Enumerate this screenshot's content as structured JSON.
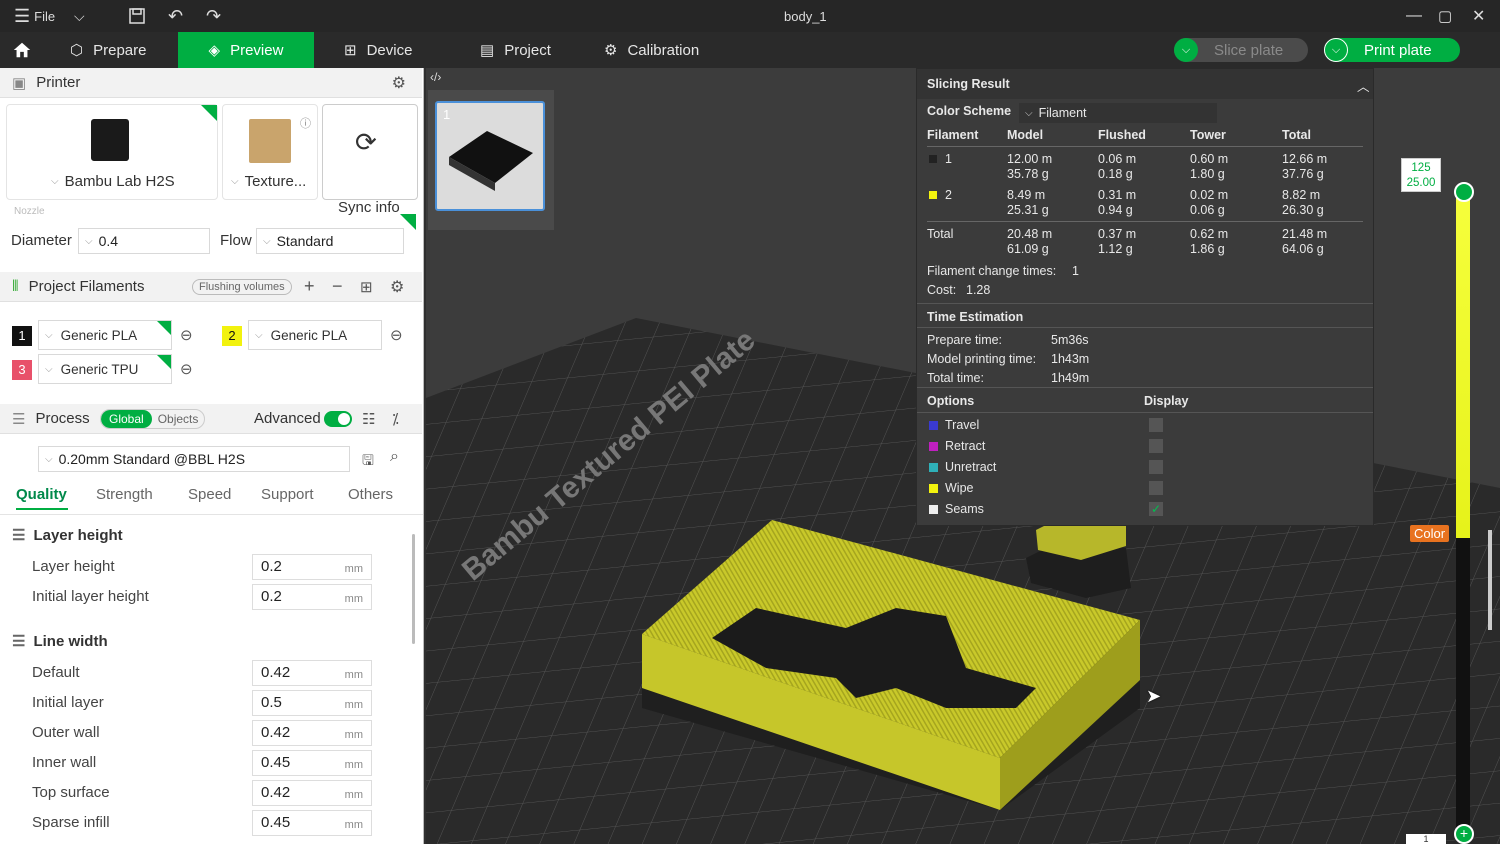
{
  "title": {
    "menu_icon": "hamburger-icon",
    "file": "File",
    "doc": "body_1"
  },
  "nav": {
    "home": "home-icon",
    "prepare": "Prepare",
    "preview": "Preview",
    "device": "Device",
    "project": "Project",
    "calibration": "Calibration",
    "slice": "Slice plate",
    "print": "Print plate"
  },
  "printer": {
    "header": "Printer",
    "model": "Bambu Lab H2S",
    "plate": "Texture...",
    "sync": "Sync info",
    "nozzle": "Nozzle",
    "diameter_label": "Diameter",
    "diameter": "0.4",
    "flow_label": "Flow",
    "flow": "Standard"
  },
  "filaments": {
    "header": "Project Filaments",
    "flushing": "Flushing volumes",
    "items": [
      {
        "idx": "1",
        "name": "Generic PLA",
        "color": "#111111"
      },
      {
        "idx": "2",
        "name": "Generic PLA",
        "color": "#f2f20e"
      },
      {
        "idx": "3",
        "name": "Generic TPU",
        "color": "#e8516a"
      }
    ]
  },
  "process": {
    "header": "Process",
    "global": "Global",
    "objects": "Objects",
    "advanced": "Advanced",
    "preset": "0.20mm Standard @BBL H2S",
    "tabs": [
      "Quality",
      "Strength",
      "Speed",
      "Support",
      "Others"
    ],
    "g1": "Layer height",
    "g2": "Line width",
    "rows": [
      {
        "label": "Layer height",
        "value": "0.2",
        "unit": "mm"
      },
      {
        "label": "Initial layer height",
        "value": "0.2",
        "unit": "mm"
      },
      {
        "label": "Default",
        "value": "0.42",
        "unit": "mm"
      },
      {
        "label": "Initial layer",
        "value": "0.5",
        "unit": "mm"
      },
      {
        "label": "Outer wall",
        "value": "0.42",
        "unit": "mm"
      },
      {
        "label": "Inner wall",
        "value": "0.45",
        "unit": "mm"
      },
      {
        "label": "Top surface",
        "value": "0.42",
        "unit": "mm"
      },
      {
        "label": "Sparse infill",
        "value": "0.45",
        "unit": "mm"
      }
    ]
  },
  "thumb": {
    "index": "1"
  },
  "result": {
    "header": "Slicing Result",
    "scheme_label": "Color Scheme",
    "scheme": "Filament",
    "cols": [
      "Filament",
      "Model",
      "Flushed",
      "Tower",
      "Total"
    ],
    "rows": [
      {
        "f": "1",
        "sw": "#222222",
        "model": [
          "12.00 m",
          "35.78 g"
        ],
        "flushed": [
          "0.06 m",
          "0.18 g"
        ],
        "tower": [
          "0.60 m",
          "1.80 g"
        ],
        "total": [
          "12.66 m",
          "37.76 g"
        ]
      },
      {
        "f": "2",
        "sw": "#f2f20e",
        "model": [
          "8.49 m",
          "25.31 g"
        ],
        "flushed": [
          "0.31 m",
          "0.94 g"
        ],
        "tower": [
          "0.02 m",
          "0.06 g"
        ],
        "total": [
          "8.82 m",
          "26.30 g"
        ]
      }
    ],
    "total": {
      "label": "Total",
      "model": [
        "20.48 m",
        "61.09 g"
      ],
      "flushed": [
        "0.37 m",
        "1.12 g"
      ],
      "tower": [
        "0.62 m",
        "1.86 g"
      ],
      "total": [
        "21.48 m",
        "64.06 g"
      ]
    },
    "change": "Filament change times:",
    "change_val": "1",
    "cost": "Cost:",
    "cost_val": "1.28",
    "time_header": "Time Estimation",
    "times": [
      {
        "l": "Prepare time:",
        "v": "5m36s"
      },
      {
        "l": "Model printing time:",
        "v": "1h43m"
      },
      {
        "l": "Total time:",
        "v": "1h49m"
      }
    ],
    "options_label": "Options",
    "display_label": "Display",
    "options": [
      {
        "n": "Travel",
        "c": "#3a3ad0",
        "on": false
      },
      {
        "n": "Retract",
        "c": "#c020c0",
        "on": false
      },
      {
        "n": "Unretract",
        "c": "#2fb0b8",
        "on": false
      },
      {
        "n": "Wipe",
        "c": "#f2f20e",
        "on": false
      },
      {
        "n": "Seams",
        "c": "#eeeeee",
        "on": true
      }
    ]
  },
  "layer": {
    "top": "125",
    "height": "25.00",
    "bottom": "1",
    "color_btn": "Color"
  },
  "plate_text": "Bambu Textured PEI Plate"
}
